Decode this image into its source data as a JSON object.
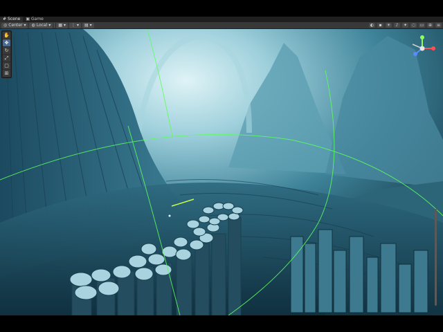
{
  "tabs": [
    {
      "label": "Scene",
      "icon": "hash-icon",
      "active": true
    },
    {
      "label": "Game",
      "icon": "gamepad-icon",
      "active": false
    }
  ],
  "toolbar": {
    "pivot_label": "Center",
    "space_label": "Local",
    "grid_icon": "grid-icon",
    "snap_icon": "snap-icon"
  },
  "tools": [
    {
      "name": "view-tool",
      "icon": "hand-icon",
      "glyph": "✋"
    },
    {
      "name": "move-tool",
      "icon": "move-icon",
      "glyph": "✥"
    },
    {
      "name": "rotate-tool",
      "icon": "rotate-icon",
      "glyph": "↻"
    },
    {
      "name": "scale-tool",
      "icon": "scale-icon",
      "glyph": "⤢"
    },
    {
      "name": "rect-tool",
      "icon": "rect-icon",
      "glyph": "▢"
    },
    {
      "name": "transform-tool",
      "icon": "transform-icon",
      "glyph": "⊞"
    }
  ],
  "colors": {
    "gizmo_line": "#5cff5c",
    "axis_x": "#ff4f4f",
    "axis_y": "#8bff5c",
    "axis_z": "#5b8cff"
  }
}
